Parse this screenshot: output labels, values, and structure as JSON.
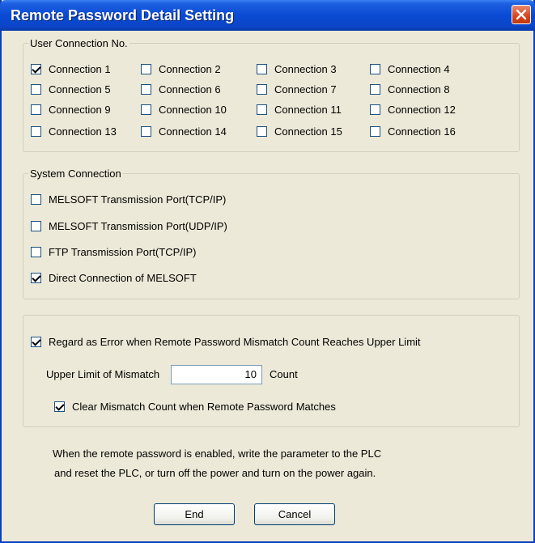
{
  "window": {
    "title": "Remote Password Detail Setting"
  },
  "user_connection": {
    "legend": "User Connection No.",
    "items": [
      {
        "label": "Connection 1",
        "checked": true
      },
      {
        "label": "Connection 2",
        "checked": false
      },
      {
        "label": "Connection 3",
        "checked": false
      },
      {
        "label": "Connection 4",
        "checked": false
      },
      {
        "label": "Connection 5",
        "checked": false
      },
      {
        "label": "Connection 6",
        "checked": false
      },
      {
        "label": "Connection 7",
        "checked": false
      },
      {
        "label": "Connection 8",
        "checked": false
      },
      {
        "label": "Connection 9",
        "checked": false
      },
      {
        "label": "Connection 10",
        "checked": false
      },
      {
        "label": "Connection 11",
        "checked": false
      },
      {
        "label": "Connection 12",
        "checked": false
      },
      {
        "label": "Connection 13",
        "checked": false
      },
      {
        "label": "Connection 14",
        "checked": false
      },
      {
        "label": "Connection 15",
        "checked": false
      },
      {
        "label": "Connection 16",
        "checked": false
      }
    ]
  },
  "system_connection": {
    "legend": "System Connection",
    "items": [
      {
        "label": "MELSOFT Transmission Port(TCP/IP)",
        "checked": false
      },
      {
        "label": "MELSOFT Transmission Port(UDP/IP)",
        "checked": false
      },
      {
        "label": "FTP Transmission Port(TCP/IP)",
        "checked": false
      },
      {
        "label": "Direct Connection of MELSOFT",
        "checked": true
      }
    ]
  },
  "mismatch": {
    "regard_error_label": "Regard as Error when Remote Password Mismatch Count Reaches Upper Limit",
    "regard_error_checked": true,
    "upper_limit_label": "Upper Limit of Mismatch",
    "upper_limit_value": "10",
    "count_label": "Count",
    "clear_label": "Clear Mismatch Count when Remote Password Matches",
    "clear_checked": true
  },
  "note": {
    "line1": "When the remote password is enabled, write the parameter to the PLC",
    "line2": "and reset the PLC, or turn off the power and turn on the power again."
  },
  "buttons": {
    "end": "End",
    "cancel": "Cancel"
  }
}
